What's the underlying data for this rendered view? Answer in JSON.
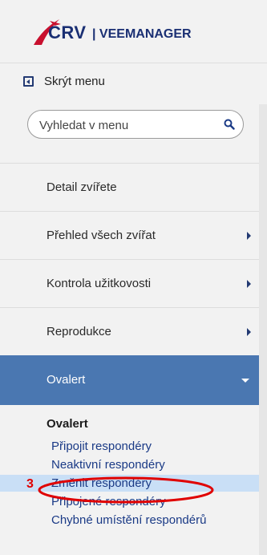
{
  "brand": {
    "logo_text": "CRV",
    "app_name": "| VEEMANAGER",
    "logo_colors": {
      "swoosh": "#c8102e",
      "text": "#1a2f73"
    }
  },
  "hide_menu": {
    "label": "Skrýt menu",
    "icon": "collapse-left-icon"
  },
  "search": {
    "placeholder": "Vyhledat v menu",
    "value": "",
    "icon": "search-icon"
  },
  "menu": {
    "items": [
      {
        "label": "Detail zvířete",
        "has_submenu": false
      },
      {
        "label": "Přehled všech zvířat",
        "has_submenu": true
      },
      {
        "label": "Kontrola užitkovosti",
        "has_submenu": true
      },
      {
        "label": "Reprodukce",
        "has_submenu": true
      },
      {
        "label": "Ovalert",
        "has_submenu": true,
        "expanded": true
      }
    ]
  },
  "submenu": {
    "heading": "Ovalert",
    "items": [
      {
        "label": "Připojit respondéry"
      },
      {
        "label": "Neaktivní respondéry"
      },
      {
        "label": "Změnit respondéry",
        "selected": true
      },
      {
        "label": "Připojené respondéry"
      },
      {
        "label": "Chybné umístění respondérů"
      }
    ]
  },
  "annotation": {
    "number": "3",
    "color": "#e00000"
  },
  "colors": {
    "active_bg": "#4a77b1",
    "selected_bg": "#c9dff6",
    "link": "#1a3a86"
  }
}
